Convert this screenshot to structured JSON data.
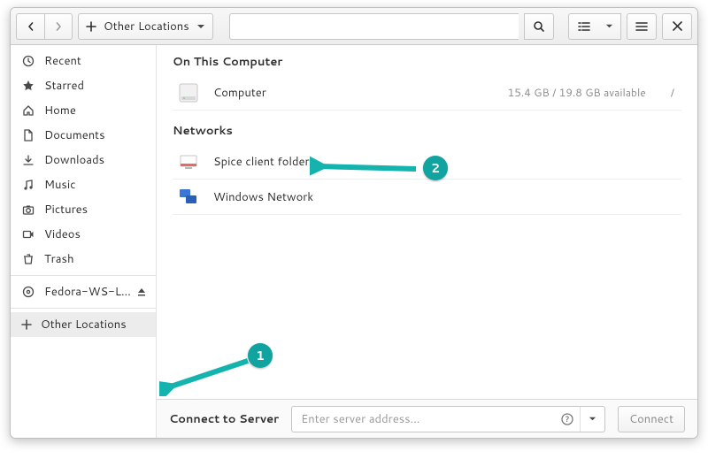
{
  "path": {
    "label": "Other Locations"
  },
  "sidebar": {
    "items": [
      {
        "label": "Recent"
      },
      {
        "label": "Starred"
      },
      {
        "label": "Home"
      },
      {
        "label": "Documents"
      },
      {
        "label": "Downloads"
      },
      {
        "label": "Music"
      },
      {
        "label": "Pictures"
      },
      {
        "label": "Videos"
      },
      {
        "label": "Trash"
      }
    ],
    "device": {
      "label": "Fedora-WS-L…"
    },
    "other": {
      "label": "Other Locations"
    }
  },
  "main": {
    "section1": {
      "title": "On This Computer"
    },
    "computer": {
      "name": "Computer",
      "meta": "15.4 GB / 19.8 GB available",
      "path": "/"
    },
    "section2": {
      "title": "Networks"
    },
    "spice": {
      "name": "Spice client folder"
    },
    "winnet": {
      "name": "Windows Network"
    }
  },
  "footer": {
    "label": "Connect to Server",
    "placeholder": "Enter server address…",
    "connect": "Connect"
  },
  "annot": {
    "one": "1",
    "two": "2"
  }
}
